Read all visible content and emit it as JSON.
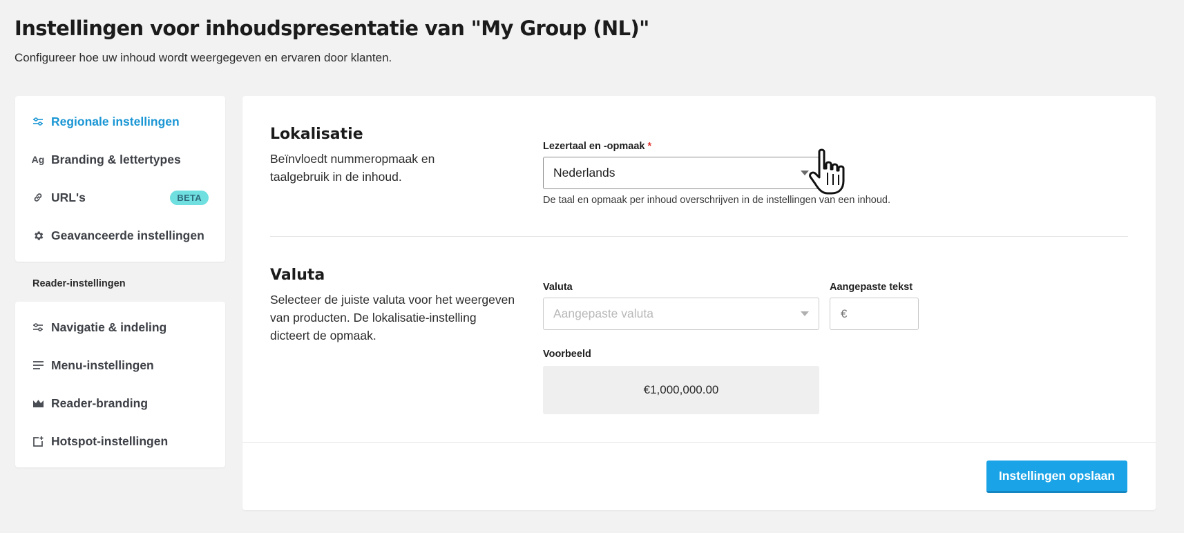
{
  "header": {
    "title": "Instellingen voor inhoudspresentatie van \"My Group (NL)\"",
    "subtitle": "Configureer hoe uw inhoud wordt weergegeven en ervaren door klanten."
  },
  "sidebar": {
    "top_items": [
      {
        "label": "Regionale instellingen",
        "icon": "sliders-icon",
        "active": true
      },
      {
        "label": "Branding & lettertypes",
        "icon": "typography-icon"
      },
      {
        "label": "URL's",
        "icon": "link-icon",
        "badge": "BETA"
      },
      {
        "label": "Geavanceerde instellingen",
        "icon": "gear-icon"
      }
    ],
    "section_label": "Reader-instellingen",
    "bottom_items": [
      {
        "label": "Navigatie & indeling",
        "icon": "sliders-icon"
      },
      {
        "label": "Menu-instellingen",
        "icon": "menu-lines-icon"
      },
      {
        "label": "Reader-branding",
        "icon": "crown-icon"
      },
      {
        "label": "Hotspot-instellingen",
        "icon": "hotspot-add-icon"
      }
    ]
  },
  "localization": {
    "title": "Lokalisatie",
    "description": "Beïnvloedt nummeropmaak en taalgebruik in de inhoud.",
    "field_label": "Lezertaal en -opmaak",
    "required_mark": "*",
    "selected_value": "Nederlands",
    "hint": "De taal en opmaak per inhoud overschrijven in de instellingen van een inhoud."
  },
  "currency": {
    "title": "Valuta",
    "description": "Selecteer de juiste valuta voor het weergeven van producten. De lokalisatie-instelling dicteert de opmaak.",
    "currency_label": "Valuta",
    "currency_placeholder": "Aangepaste valuta",
    "custom_text_label": "Aangepaste tekst",
    "custom_text_placeholder": "€",
    "preview_label": "Voorbeeld",
    "preview_value": "€1,000,000.00"
  },
  "footer": {
    "save_label": "Instellingen opslaan"
  },
  "colors": {
    "accent": "#1aa3e6",
    "active_nav": "#1a96d4",
    "beta_badge": "#6fdfe0",
    "required": "#e0312f",
    "background": "#f2f2f2"
  }
}
